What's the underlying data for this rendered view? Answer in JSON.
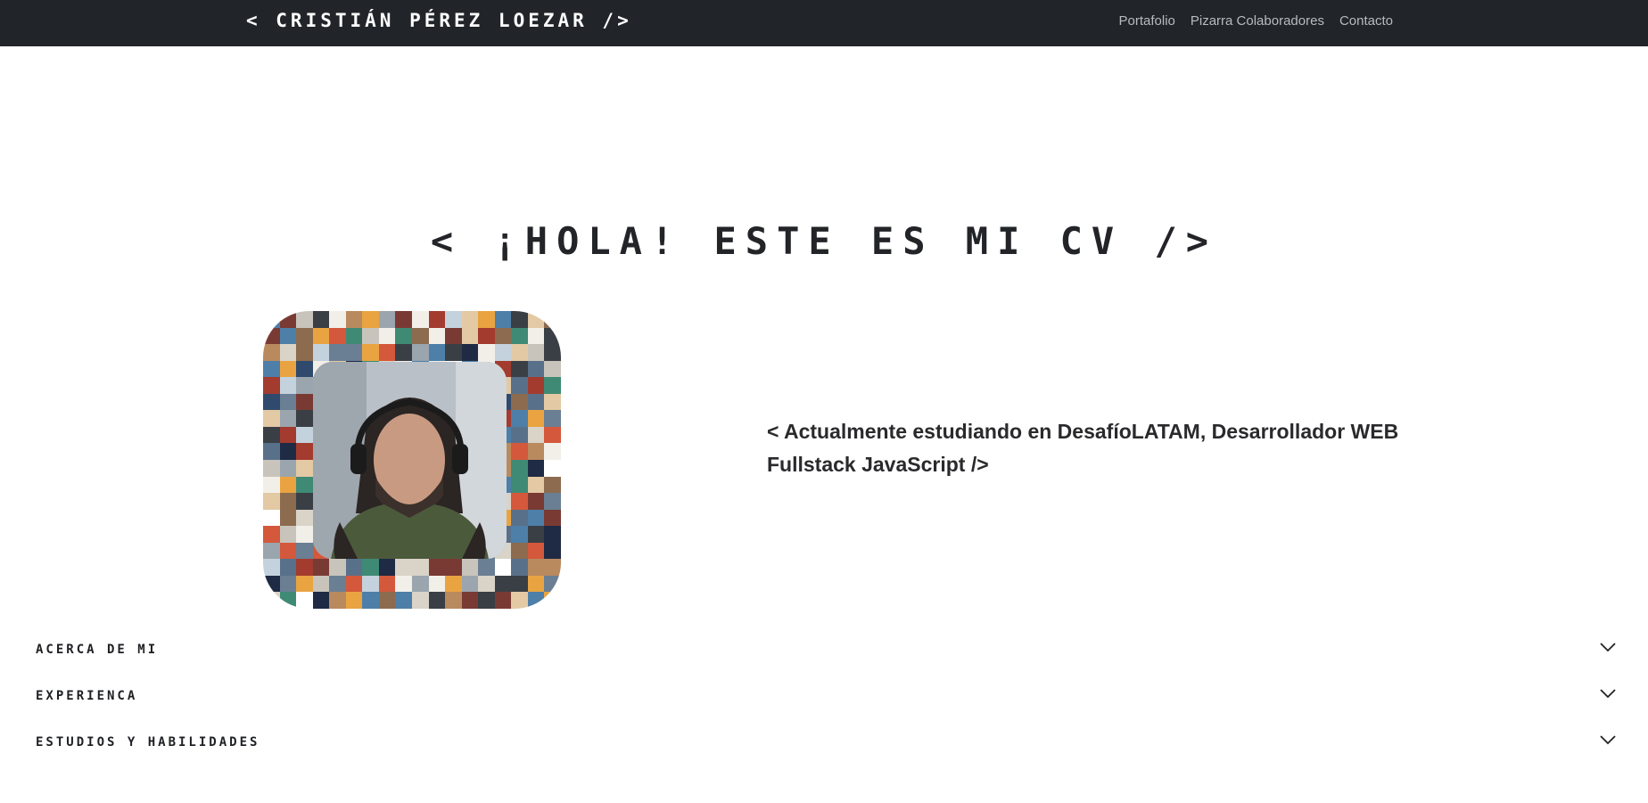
{
  "navbar": {
    "brand": "< CRISTIÁN PÉREZ LOEZAR />",
    "links": [
      {
        "label": "Portafolio"
      },
      {
        "label": "Pizarra Colaboradores"
      },
      {
        "label": "Contacto"
      }
    ]
  },
  "hero": {
    "title": "< ¡HOLA! ESTE ES MI CV />",
    "intro": "< Actualmente estudiando en DesafíoLATAM, Desarrollador WEB Fullstack JavaScript />"
  },
  "avatar": {
    "mosaic_palette": [
      "#2f4a6d",
      "#e9a441",
      "#c9c4bb",
      "#8c6b4f",
      "#3a3f46",
      "#a33b2f",
      "#d9d3c8",
      "#6a7f94",
      "#f2efe9",
      "#4d7fa8",
      "#b98a5e",
      "#7a3a34",
      "#1f2a44",
      "#e3c9a4",
      "#59708a",
      "#c4d2dd",
      "#ffffff",
      "#9aa5ae",
      "#d4583b",
      "#3f8a74"
    ]
  },
  "accordion": {
    "items": [
      {
        "label": "ACERCA DE MI",
        "icon": "chevron-down-icon"
      },
      {
        "label": "EXPERIENCA",
        "icon": "chevron-down-icon"
      },
      {
        "label": "ESTUDIOS Y HABILIDADES",
        "icon": "chevron-down-icon"
      }
    ]
  },
  "colors": {
    "navbar_bg": "#212529",
    "nav_link": "#b7bbc0",
    "text_dark": "#222428"
  }
}
